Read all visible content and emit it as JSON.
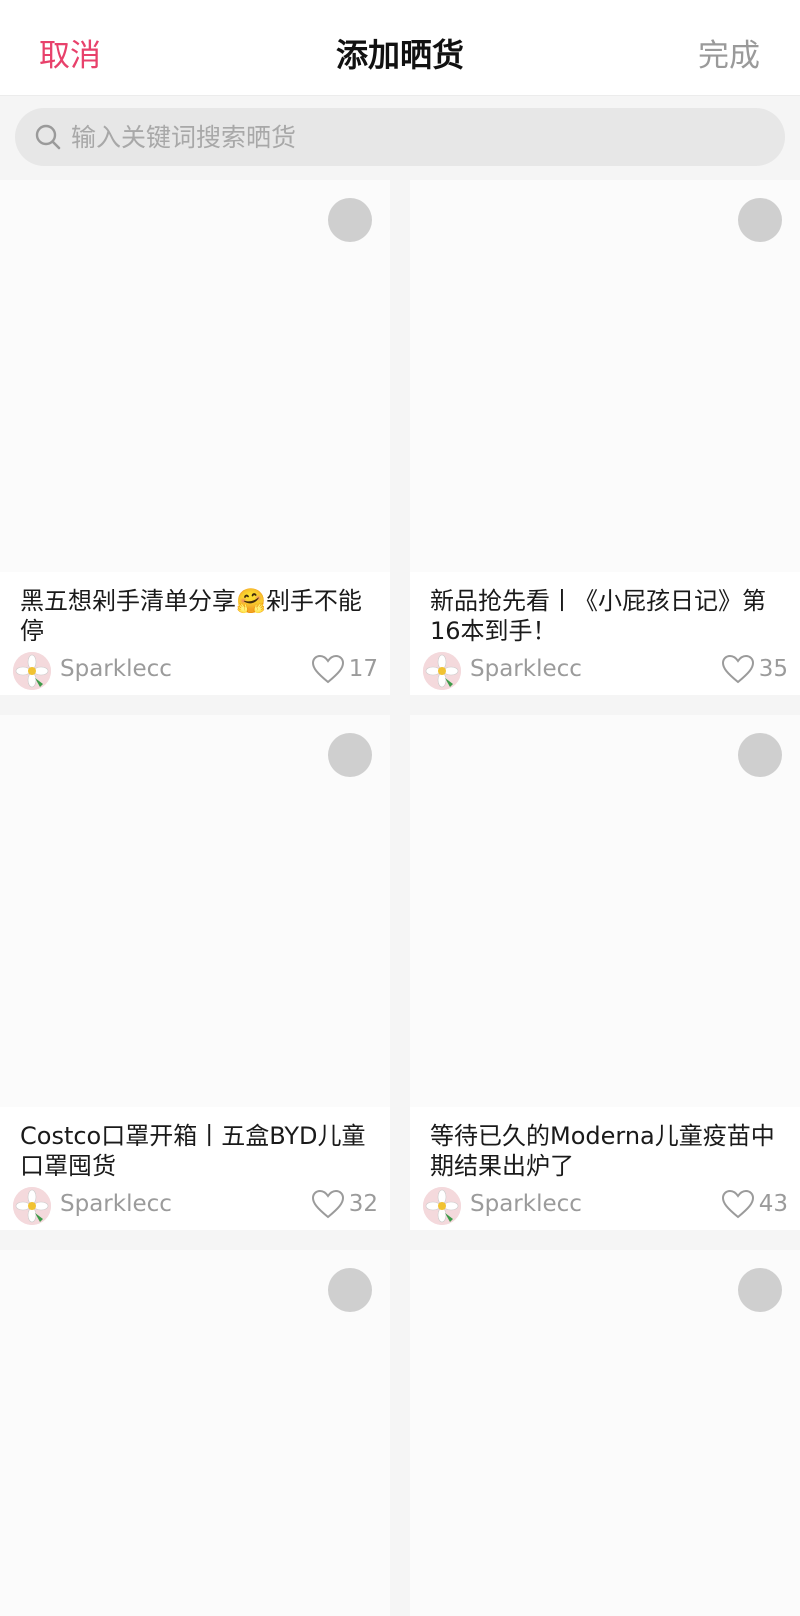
{
  "header": {
    "cancel_label": "取消",
    "title": "添加晒货",
    "done_label": "完成"
  },
  "search": {
    "placeholder": "输入关键词搜索晒货",
    "value": ""
  },
  "colors": {
    "accent": "#e8416b",
    "done_inactive": "#9a9a9a",
    "select_circle": "#cfcfcf"
  },
  "cards": [
    {
      "title": "黑五想剁手清单分享🤗剁手不能停",
      "author": "Sparklecc",
      "likes": "17"
    },
    {
      "title": "新品抢先看丨《小屁孩日记》第16本到手！",
      "author": "Sparklecc",
      "likes": "35"
    },
    {
      "title": "Costco口罩开箱丨五盒BYD儿童口罩囤货",
      "author": "Sparklecc",
      "likes": "32"
    },
    {
      "title": "等待已久的Moderna儿童疫苗中期结果出炉了",
      "author": "Sparklecc",
      "likes": "43"
    }
  ]
}
